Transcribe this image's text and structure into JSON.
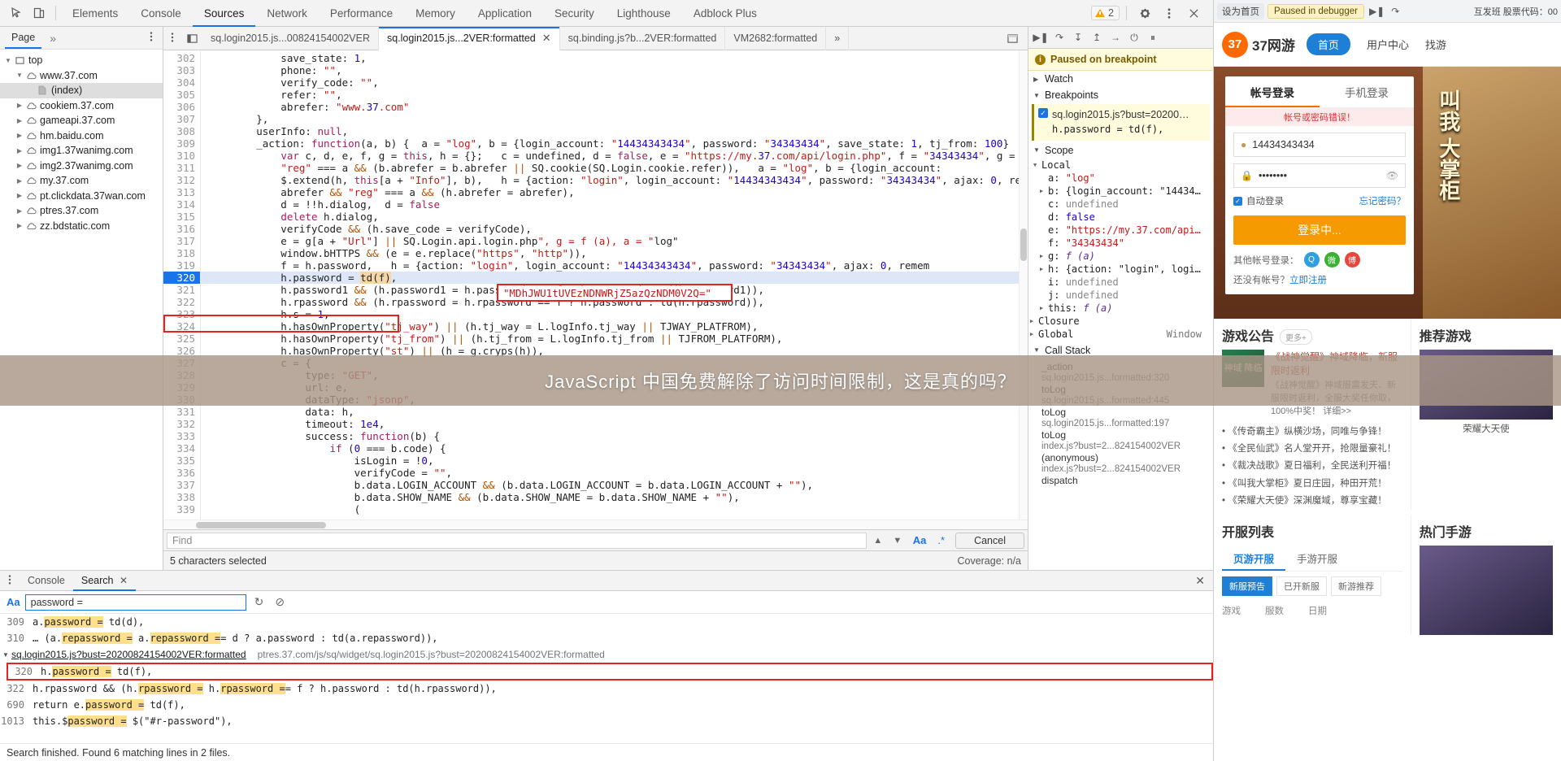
{
  "devtools": {
    "toolbar": {
      "icons": [
        "inspect-icon",
        "device-toolbar-icon"
      ],
      "tabs": [
        {
          "label": "Elements",
          "active": false
        },
        {
          "label": "Console",
          "active": false
        },
        {
          "label": "Sources",
          "active": true
        },
        {
          "label": "Network",
          "active": false
        },
        {
          "label": "Performance",
          "active": false
        },
        {
          "label": "Memory",
          "active": false
        },
        {
          "label": "Application",
          "active": false
        },
        {
          "label": "Security",
          "active": false
        },
        {
          "label": "Lighthouse",
          "active": false
        },
        {
          "label": "Adblock Plus",
          "active": false
        }
      ],
      "warning_count": "2",
      "right_icons": [
        "settings-gear-icon",
        "more-options-icon",
        "close-icon"
      ]
    },
    "navigator": {
      "tab": "Page",
      "more": "»",
      "tree": [
        {
          "label": "top",
          "depth": 0,
          "icon": "frame-icon",
          "arrow": "▼",
          "selected": false
        },
        {
          "label": "www.37.com",
          "depth": 1,
          "icon": "cloud-icon",
          "arrow": "▼",
          "selected": false
        },
        {
          "label": "(index)",
          "depth": 2,
          "icon": "document-icon",
          "arrow": "",
          "selected": true
        },
        {
          "label": "cookiem.37.com",
          "depth": 1,
          "icon": "cloud-icon",
          "arrow": "▶",
          "selected": false
        },
        {
          "label": "gameapi.37.com",
          "depth": 1,
          "icon": "cloud-icon",
          "arrow": "▶",
          "selected": false
        },
        {
          "label": "hm.baidu.com",
          "depth": 1,
          "icon": "cloud-icon",
          "arrow": "▶",
          "selected": false
        },
        {
          "label": "img1.37wanimg.com",
          "depth": 1,
          "icon": "cloud-icon",
          "arrow": "▶",
          "selected": false
        },
        {
          "label": "img2.37wanimg.com",
          "depth": 1,
          "icon": "cloud-icon",
          "arrow": "▶",
          "selected": false
        },
        {
          "label": "my.37.com",
          "depth": 1,
          "icon": "cloud-icon",
          "arrow": "▶",
          "selected": false
        },
        {
          "label": "pt.clickdata.37wan.com",
          "depth": 1,
          "icon": "cloud-icon",
          "arrow": "▶",
          "selected": false
        },
        {
          "label": "ptres.37.com",
          "depth": 1,
          "icon": "cloud-icon",
          "arrow": "▶",
          "selected": false
        },
        {
          "label": "zz.bdstatic.com",
          "depth": 1,
          "icon": "cloud-icon",
          "arrow": "▶",
          "selected": false
        }
      ]
    },
    "editor_tabs": [
      {
        "label": "sq.login2015.js...00824154002VER",
        "active": false,
        "closable": false
      },
      {
        "label": "sq.login2015.js...2VER:formatted",
        "active": true,
        "closable": true
      },
      {
        "label": "sq.binding.js?b...2VER:formatted",
        "active": false,
        "closable": false
      },
      {
        "label": "VM2682:formatted",
        "active": false,
        "closable": false
      },
      {
        "label": "»",
        "active": false,
        "closable": false
      }
    ],
    "code": {
      "first_line": 302,
      "breakpoint_line": 320,
      "lines": [
        "            save_state: 1,",
        "            phone: \"\",",
        "            verify_code: \"\",",
        "            refer: \"\",",
        "            abrefer: \"www.37.com\"",
        "        },",
        "        userInfo: null,",
        "        _action: function(a, b) {  a = \"log\", b = {login_account: \"14434343434\", password: \"34343434\", save_state: 1, tj_from: 100}",
        "            var c, d, e, f, g = this, h = {};   c = undefined, d = false, e = \"https://my.37.com/api/login.php\", f = \"34343434\", g = f",
        "            \"reg\" === a && (b.abrefer = b.abrefer || SQ.cookie(SQ.Login.cookie.refer)),   a = \"log\", b = {login_account:",
        "            $.extend(h, this[a + \"Info\"], b),   h = {action: \"login\", login_account: \"14434343434\", password: \"34343434\", ajax: 0, rem",
        "            abrefer && \"reg\" === a && (h.abrefer = abrefer),",
        "            d = !!h.dialog,  d = false",
        "            delete h.dialog,",
        "            verifyCode && (h.save_code = verifyCode),",
        "            e = g[a + \"Url\"] || SQ.Login.api.login.php\", g = f (a), a = \"log\"",
        "            window.bHTTPS && (e = e.replace(\"https\", \"http\")),",
        "            f = h.password,   h = {action: \"login\", login_account: \"14434343434\", password: \"34343434\", ajax: 0, remem",
        "            h.password = td(f),",
        "            h.password1 && (h.password1 = h.password1 == f ? h.password : td(h.password1)),",
        "            h.rpassword && (h.rpassword = h.rpassword == f ? h.password : td(h.rpassword)),",
        "            h.s = 1,",
        "            h.hasOwnProperty(\"tj_way\") || (h.tj_way = L.logInfo.tj_way || TJWAY_PLATFROM),",
        "            h.hasOwnProperty(\"tj_from\") || (h.tj_from = L.logInfo.tj_from || TJFROM_PLATFORM),",
        "            h.hasOwnProperty(\"st\") || (h = g.cryps(h)),",
        "            c = {",
        "                type: \"GET\",",
        "                url: e,",
        "                dataType: \"jsonp\",",
        "                data: h,",
        "                timeout: 1e4,",
        "                success: function(b) {",
        "                    if (0 === b.code) {",
        "                        isLogin = !0,",
        "                        verifyCode = \"\",",
        "                        b.data.LOGIN_ACCOUNT && (b.data.LOGIN_ACCOUNT = b.data.LOGIN_ACCOUNT + \"\"),",
        "                        b.data.SHOW_NAME && (b.data.SHOW_NAME = b.data.SHOW_NAME + \"\"),",
        "                        ("
      ],
      "hash_string": "\"MDhJWU1tUVEzNDNWRjZ5azQzNDM0V2Q=\"",
      "selected_token": "td(f)"
    },
    "find": {
      "placeholder": "Find",
      "aa_label": "Aa",
      "regex_label": ".*",
      "cancel_label": "Cancel"
    },
    "status": {
      "selection": "5 characters selected",
      "coverage": "Coverage: n/a"
    },
    "debugger": {
      "controls": [
        "resume-icon",
        "step-over-icon",
        "step-into-icon",
        "step-out-icon",
        "step-icon",
        "deactivate-breakpoints-icon",
        "pause-on-exceptions-icon"
      ],
      "paused_title": "Paused on breakpoint",
      "watch_label": "Watch",
      "breakpoints_label": "Breakpoints",
      "breakpoint": {
        "file": "sq.login2015.js?bust=20200…",
        "code": "h.password = td(f),",
        "checked": true
      },
      "scope_label": "Scope",
      "local_label": "Local",
      "locals": [
        {
          "arrow": "",
          "name": "a",
          "value": "\"log\"",
          "type": "str"
        },
        {
          "arrow": "▶",
          "name": "b",
          "value": "{login_account: \"14434…",
          "type": "obj"
        },
        {
          "arrow": "",
          "name": "c",
          "value": "undefined",
          "type": "undef"
        },
        {
          "arrow": "",
          "name": "d",
          "value": "false",
          "type": "bool"
        },
        {
          "arrow": "",
          "name": "e",
          "value": "\"https://my.37.com/api…",
          "type": "str"
        },
        {
          "arrow": "",
          "name": "f",
          "value": "\"34343434\"",
          "type": "str"
        },
        {
          "arrow": "▶",
          "name": "g",
          "value": "f (a)",
          "type": "fn"
        },
        {
          "arrow": "▶",
          "name": "h",
          "value": "{action: \"login\", logi…",
          "type": "obj"
        },
        {
          "arrow": "",
          "name": "i",
          "value": "undefined",
          "type": "undef"
        },
        {
          "arrow": "",
          "name": "j",
          "value": "undefined",
          "type": "undef"
        },
        {
          "arrow": "▶",
          "name": "this",
          "value": "f (a)",
          "type": "fn"
        }
      ],
      "closure_label": "Closure",
      "global_label": "Global",
      "global_value": "Window",
      "callstack_label": "Call Stack",
      "callstack": [
        {
          "name": "_action",
          "sub": "sq.login2015.js...formatted:320"
        },
        {
          "name": "toLog",
          "sub": "sq.login2015.js...formatted:445"
        },
        {
          "name": "toLog",
          "sub": "sq.login2015.js...formatted:197"
        },
        {
          "name": "toLog",
          "sub": "index.js?bust=2...824154002VER"
        },
        {
          "name": "(anonymous)",
          "sub": "index.js?bust=2...824154002VER"
        },
        {
          "name": "dispatch",
          "sub": ""
        }
      ]
    },
    "drawer": {
      "tabs": [
        {
          "label": "Console",
          "active": false,
          "closable": false
        },
        {
          "label": "Search",
          "active": true,
          "closable": true
        }
      ],
      "close_icon": "close-icon",
      "search": {
        "aa_label": "Aa",
        "value": "password =",
        "refresh_icon": "refresh-icon",
        "clear_icon": "clear-icon"
      },
      "results": [
        {
          "kind": "result",
          "num": "309",
          "text": "a.password = td(d),",
          "marks": [
            "password ="
          ]
        },
        {
          "kind": "result",
          "num": "310",
          "text": "… (a.repassword = a.repassword == d ? a.password : td(a.repassword)),",
          "marks": [
            "repassword ="
          ]
        },
        {
          "kind": "file",
          "num": "",
          "text": "sq.login2015.js?bust=20200824154002VER:formatted",
          "path": "ptres.37.com/js/sq/widget/sq.login2015.js?bust=20200824154002VER:formatted"
        },
        {
          "kind": "result",
          "num": "320",
          "text": "h.password = td(f),",
          "boxed": true,
          "marks": [
            "password ="
          ]
        },
        {
          "kind": "result",
          "num": "322",
          "text": "h.rpassword && (h.rpassword = h.rpassword == f ? h.password : td(h.rpassword)),",
          "marks": [
            "rpassword ="
          ]
        },
        {
          "kind": "result",
          "num": "690",
          "text": "return e.password = td(f),",
          "marks": [
            "password ="
          ]
        },
        {
          "kind": "result",
          "num": "1013",
          "text": "this.$password = $(\"#r-password\"),",
          "marks": [
            "password ="
          ]
        }
      ],
      "footer": "Search finished. Found 6 matching lines in 2 files."
    }
  },
  "browser": {
    "topbar": {
      "pin_label": "设为首页",
      "paused_label": "Paused in debugger",
      "resume_icon": "resume-icon",
      "step_icon": "step-over-icon",
      "right_label": "互发班 股票代码：00"
    },
    "site": {
      "logo_mark": "37",
      "logo_text": "37网游",
      "nav_pill": "首页",
      "nav_links": [
        "用户中心",
        "找游"
      ],
      "hero_vertical_text": "叫我\n大掌柜"
    },
    "login": {
      "tabs": [
        {
          "label": "帐号登录",
          "active": true
        },
        {
          "label": "手机登录",
          "active": false
        }
      ],
      "error": "帐号或密码错误！",
      "account_value": "14434343434",
      "account_icon": "user-icon",
      "password_value": "••••••••",
      "password_icon": "lock-icon",
      "eye_icon": "eye-icon",
      "remember_label": "自动登录",
      "forgot_label": "忘记密码？",
      "submit_label": "登录中...",
      "other_label": "其他帐号登录：",
      "social": [
        {
          "name": "qq-icon",
          "color": "#2f9fe0",
          "glyph": "Q"
        },
        {
          "name": "wechat-icon",
          "color": "#3cb034",
          "glyph": "微"
        },
        {
          "name": "weibo-icon",
          "color": "#e8453c",
          "glyph": "博"
        }
      ],
      "register_prefix": "还没有帐号？",
      "register_link": "立即注册"
    },
    "overlay_text": "JavaScript 中国免费解除了访问时间限制，这是真的吗？",
    "news": {
      "title": "游戏公告",
      "more": "更多+",
      "feature": {
        "badge": "神域\n降临",
        "title": "《战神觉醒》神域降临，新服限时返利",
        "body": "《战神觉醒》神域服震发天、新服限时返利，全服大奖任你取，100%中奖！ 详细>>"
      },
      "items": [
        "《传奇霸主》纵横沙场，同唯与争锋！",
        "《全民仙武》名人堂开开，抢限量豪礼！",
        "《裁决战歌》夏日福利，全民送利开福！",
        "《叫我大掌柜》夏日庄园，种田开荒！",
        "《荣耀大天使》深渊魔域，尊享宝藏！"
      ]
    },
    "recommend": {
      "title": "推荐游戏",
      "items": [
        {
          "caption": "荣耀大天使"
        }
      ]
    },
    "openlist": {
      "title": "开服列表",
      "tabs": [
        {
          "label": "页游开服",
          "active": true
        },
        {
          "label": "手游开服",
          "active": false
        }
      ],
      "chips": [
        {
          "label": "新服预告",
          "on": true
        },
        {
          "label": "已开新服",
          "on": false
        },
        {
          "label": "新游推荐",
          "on": false
        }
      ],
      "headers": [
        "游戏",
        "服数",
        "日期"
      ]
    },
    "hotmobile": {
      "title": "热门手游"
    }
  }
}
